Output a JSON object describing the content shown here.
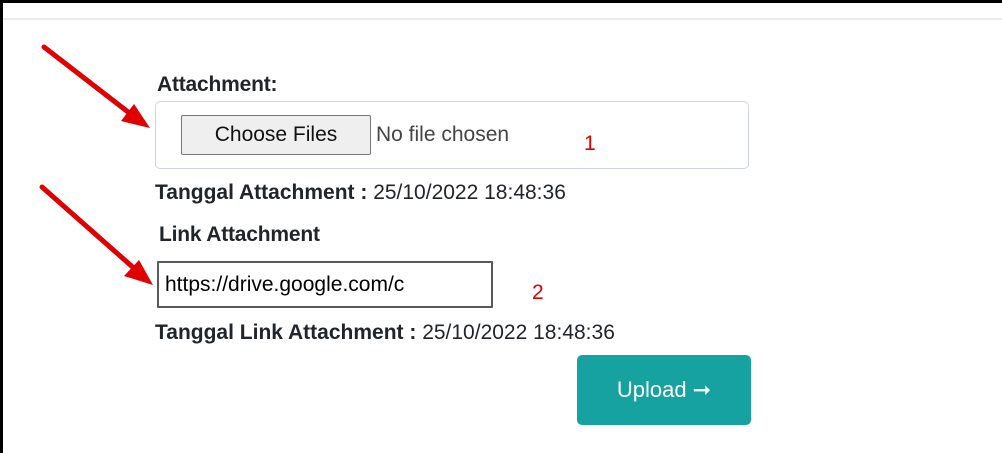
{
  "attachment": {
    "label": "Attachment:",
    "choose_button_label": "Choose Files",
    "file_status": "No file chosen",
    "date_label": "Tanggal Attachment :",
    "date_value": "25/10/2022 18:48:36"
  },
  "link_attachment": {
    "label": "Link Attachment",
    "input_value": "https://drive.google.com/c",
    "date_label": "Tanggal Link Attachment :",
    "date_value": "25/10/2022 18:48:36"
  },
  "upload": {
    "label": "Upload",
    "arrow": "➞"
  },
  "annotations": {
    "marker_1": "1",
    "marker_2": "2",
    "color": "#e00000"
  },
  "colors": {
    "accent": "#17a2a2"
  }
}
